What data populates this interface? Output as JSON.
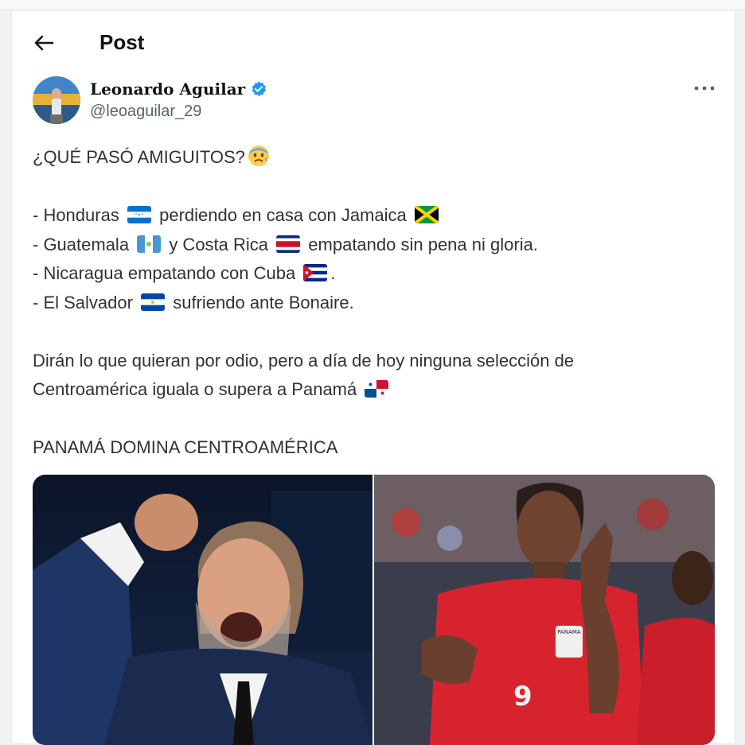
{
  "page": {
    "title": "Post"
  },
  "author": {
    "display_name": "Leonardo Aguilar",
    "handle": "@leoaguilar_29",
    "verified": true,
    "verified_color": "#1d9bf0"
  },
  "tweet": {
    "line1": "¿QUÉ PASÓ AMIGUITOS?",
    "l1a": "- Honduras",
    "l1b": "perdiendo en casa con Jamaica",
    "l2a": "- Guatemala",
    "l2b": "y Costa Rica",
    "l2c": "empatando sin pena ni gloria.",
    "l3a": "- Nicaragua empatando con Cuba",
    "l3b": ".",
    "l4a": "- El Salvador",
    "l4b": "sufriendo ante Bonaire.",
    "p2a": "Dirán lo que quieran por odio, pero a día de hoy ninguna selección de",
    "p2b": "Centroamérica iguala o supera a Panamá",
    "p3": "PANAMÁ DOMINA CENTROAMÉRICA"
  },
  "icons": [
    "back-arrow-icon",
    "verified-badge-icon",
    "more-options-icon",
    "worried-face-emoji-icon"
  ],
  "flags": [
    "honduras",
    "jamaica",
    "guatemala",
    "costa-rica",
    "cuba",
    "el-salvador",
    "panama"
  ],
  "media": {
    "left_jersey_number": "9",
    "right_badge_text": "PANAMA"
  }
}
